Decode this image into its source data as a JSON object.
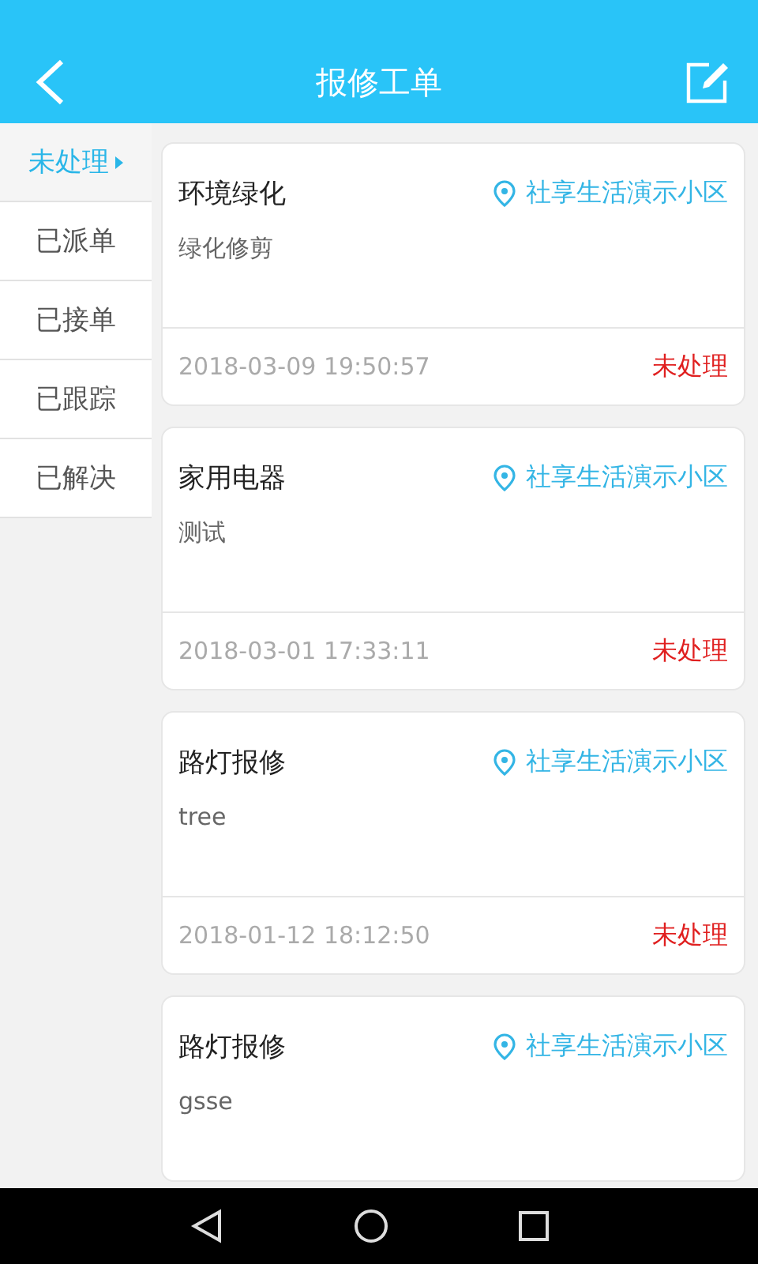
{
  "header": {
    "title": "报修工单"
  },
  "sidebar": {
    "items": [
      {
        "label": "未处理",
        "selected": true
      },
      {
        "label": "已派单",
        "selected": false
      },
      {
        "label": "已接单",
        "selected": false
      },
      {
        "label": "已跟踪",
        "selected": false
      },
      {
        "label": "已解决",
        "selected": false
      }
    ]
  },
  "orders": [
    {
      "category": "环境绿化",
      "community": "社享生活演示小区",
      "description": "绿化修剪",
      "time": "2018-03-09 19:50:57",
      "status": "未处理"
    },
    {
      "category": "家用电器",
      "community": "社享生活演示小区",
      "description": "测试",
      "time": "2018-03-01 17:33:11",
      "status": "未处理"
    },
    {
      "category": "路灯报修",
      "community": "社享生活演示小区",
      "description": "tree",
      "time": "2018-01-12 18:12:50",
      "status": "未处理"
    },
    {
      "category": "路灯报修",
      "community": "社享生活演示小区",
      "description": "gsse"
    }
  ]
}
